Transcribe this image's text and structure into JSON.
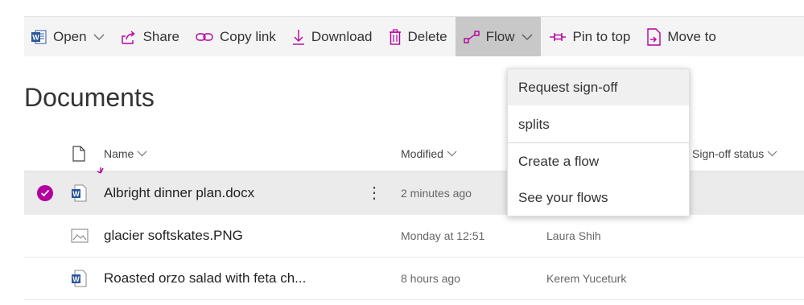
{
  "toolbar": {
    "open_label": "Open",
    "share_label": "Share",
    "copy_link_label": "Copy link",
    "download_label": "Download",
    "delete_label": "Delete",
    "flow_label": "Flow",
    "pin_label": "Pin to top",
    "move_label": "Move to",
    "accent_color": "#b4009e",
    "word_color": "#2b579a"
  },
  "page": {
    "title": "Documents"
  },
  "columns": {
    "name": "Name",
    "modified": "Modified",
    "signoff": "Sign-off status"
  },
  "files": [
    {
      "name": "Albright dinner plan.docx",
      "modified": "2 minutes ago",
      "modified_by": "",
      "type": "word",
      "selected": true,
      "new": true
    },
    {
      "name": "glacier softskates.PNG",
      "modified": "Monday at 12:51",
      "modified_by": "Laura Shih",
      "type": "image",
      "selected": false,
      "new": false
    },
    {
      "name": "Roasted orzo salad with feta ch...",
      "modified": "8 hours ago",
      "modified_by": "Kerem Yuceturk",
      "type": "word",
      "selected": false,
      "new": false
    }
  ],
  "flow_menu": {
    "items": [
      "Request sign-off",
      "splits",
      "Create a flow",
      "See your flows"
    ]
  }
}
